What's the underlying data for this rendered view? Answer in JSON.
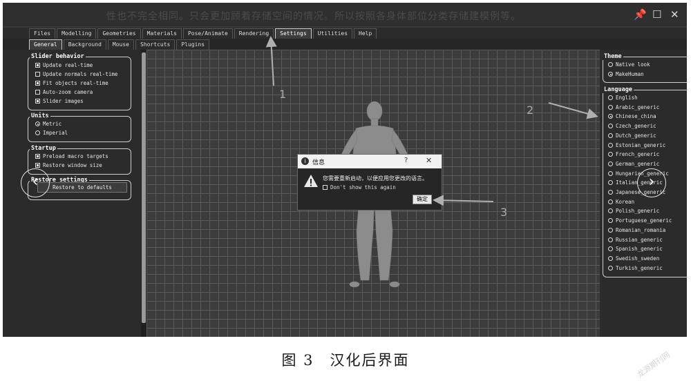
{
  "watermark_text": "性也不完全相同。只会更加顾着存储空间的情况。所以按照各身体部位分类存储建模例等。",
  "window_controls": {
    "pin": "📌",
    "maximize": "☐",
    "close": "✕"
  },
  "menu_tabs": [
    {
      "label": "Files",
      "active": false
    },
    {
      "label": "Modelling",
      "active": false
    },
    {
      "label": "Geometries",
      "active": false
    },
    {
      "label": "Materials",
      "active": false
    },
    {
      "label": "Pose/Animate",
      "active": false
    },
    {
      "label": "Rendering",
      "active": false
    },
    {
      "label": "Settings",
      "active": true
    },
    {
      "label": "Utilities",
      "active": false
    },
    {
      "label": "Help",
      "active": false
    }
  ],
  "sub_tabs": [
    {
      "label": "General",
      "active": true
    },
    {
      "label": "Background",
      "active": false
    },
    {
      "label": "Mouse",
      "active": false
    },
    {
      "label": "Shortcuts",
      "active": false
    },
    {
      "label": "Plugins",
      "active": false
    }
  ],
  "left": {
    "slider_behavior": {
      "title": "Slider behavior",
      "items": [
        {
          "label": "Update real-time",
          "checked": true
        },
        {
          "label": "Update normals real-time",
          "checked": false
        },
        {
          "label": "Fit objects real-time",
          "checked": true
        },
        {
          "label": "Auto-zoom camera",
          "checked": false
        },
        {
          "label": "Slider images",
          "checked": true
        }
      ]
    },
    "units": {
      "title": "Units",
      "items": [
        {
          "label": "Metric",
          "selected": true
        },
        {
          "label": "Imperial",
          "selected": false
        }
      ]
    },
    "startup": {
      "title": "Startup",
      "items": [
        {
          "label": "Preload macro targets",
          "checked": true
        },
        {
          "label": "Restore window size",
          "checked": true
        }
      ]
    },
    "restore": {
      "title": "Restore settings",
      "button": "Restore to defaults"
    }
  },
  "right": {
    "theme": {
      "title": "Theme",
      "items": [
        {
          "label": "Native look",
          "selected": false
        },
        {
          "label": "MakeHuman",
          "selected": true
        }
      ]
    },
    "language": {
      "title": "Language",
      "items": [
        {
          "label": "English",
          "selected": false
        },
        {
          "label": "Arabic_generic",
          "selected": false
        },
        {
          "label": "Chinese_china",
          "selected": true
        },
        {
          "label": "Czech_generic",
          "selected": false
        },
        {
          "label": "Dutch_generic",
          "selected": false
        },
        {
          "label": "Estonian_generic",
          "selected": false
        },
        {
          "label": "French_generic",
          "selected": false
        },
        {
          "label": "German_generic",
          "selected": false
        },
        {
          "label": "Hungarian_generic",
          "selected": false
        },
        {
          "label": "Italian_generic",
          "selected": false
        },
        {
          "label": "Japanese_generic",
          "selected": false
        },
        {
          "label": "Korean",
          "selected": false
        },
        {
          "label": "Polish_generic",
          "selected": false
        },
        {
          "label": "Portuguese_generic",
          "selected": false
        },
        {
          "label": "Romanian_romania",
          "selected": false
        },
        {
          "label": "Russian_generic",
          "selected": false
        },
        {
          "label": "Spanish_generic",
          "selected": false
        },
        {
          "label": "Swedish_sweden",
          "selected": false
        },
        {
          "label": "Turkish_generic",
          "selected": false
        }
      ]
    }
  },
  "nav": {
    "prev": "‹",
    "next": "›"
  },
  "dialog": {
    "info_glyph": "i",
    "title": "信息",
    "help": "?",
    "close": "✕",
    "message": "您需要重新启动，以便应用您更改的语言。",
    "checkbox_label": "Don't show this again",
    "checkbox_checked": false,
    "ok": "确定"
  },
  "annotations": [
    "1",
    "2",
    "3"
  ],
  "caption": "图 3　汉化后界面",
  "corner_watermark": "龙源期刊网"
}
